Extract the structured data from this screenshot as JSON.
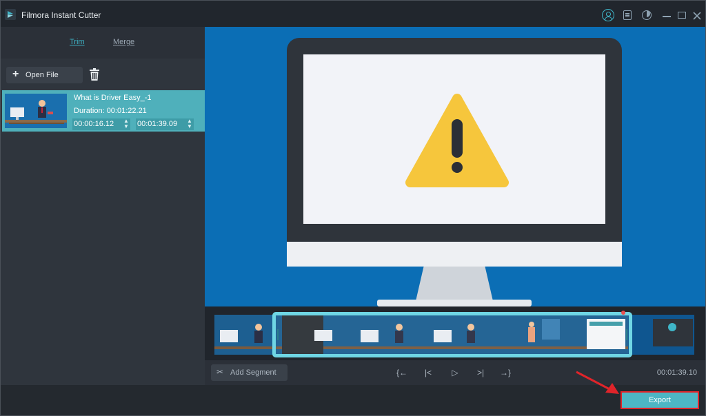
{
  "app": {
    "title": "Filmora Instant Cutter"
  },
  "titlebar": {
    "icons": [
      "user-icon",
      "document-icon",
      "theme-icon",
      "minimize-icon",
      "maximize-icon",
      "close-icon"
    ]
  },
  "tabs": {
    "trim": "Trim",
    "merge": "Merge",
    "active": "trim"
  },
  "toolbar": {
    "open_file": "Open File",
    "delete_icon": "trash-icon"
  },
  "clip": {
    "title": "What is Driver Easy_-1",
    "duration": "Duration: 00:01:22.21",
    "start": "00:00:16.12",
    "end": "00:01:39.09"
  },
  "controls": {
    "add_segment": "Add Segment",
    "buttons": [
      "mark-in-icon",
      "prev-frame-icon",
      "play-icon",
      "next-frame-icon",
      "mark-out-icon"
    ],
    "timecode": "00:01:39.10"
  },
  "footer": {
    "export": "Export"
  },
  "colors": {
    "accent": "#4cb6c4",
    "highlight_border": "#e0242a",
    "preview_bg": "#0b6eb5",
    "warning": "#f6c63c"
  }
}
